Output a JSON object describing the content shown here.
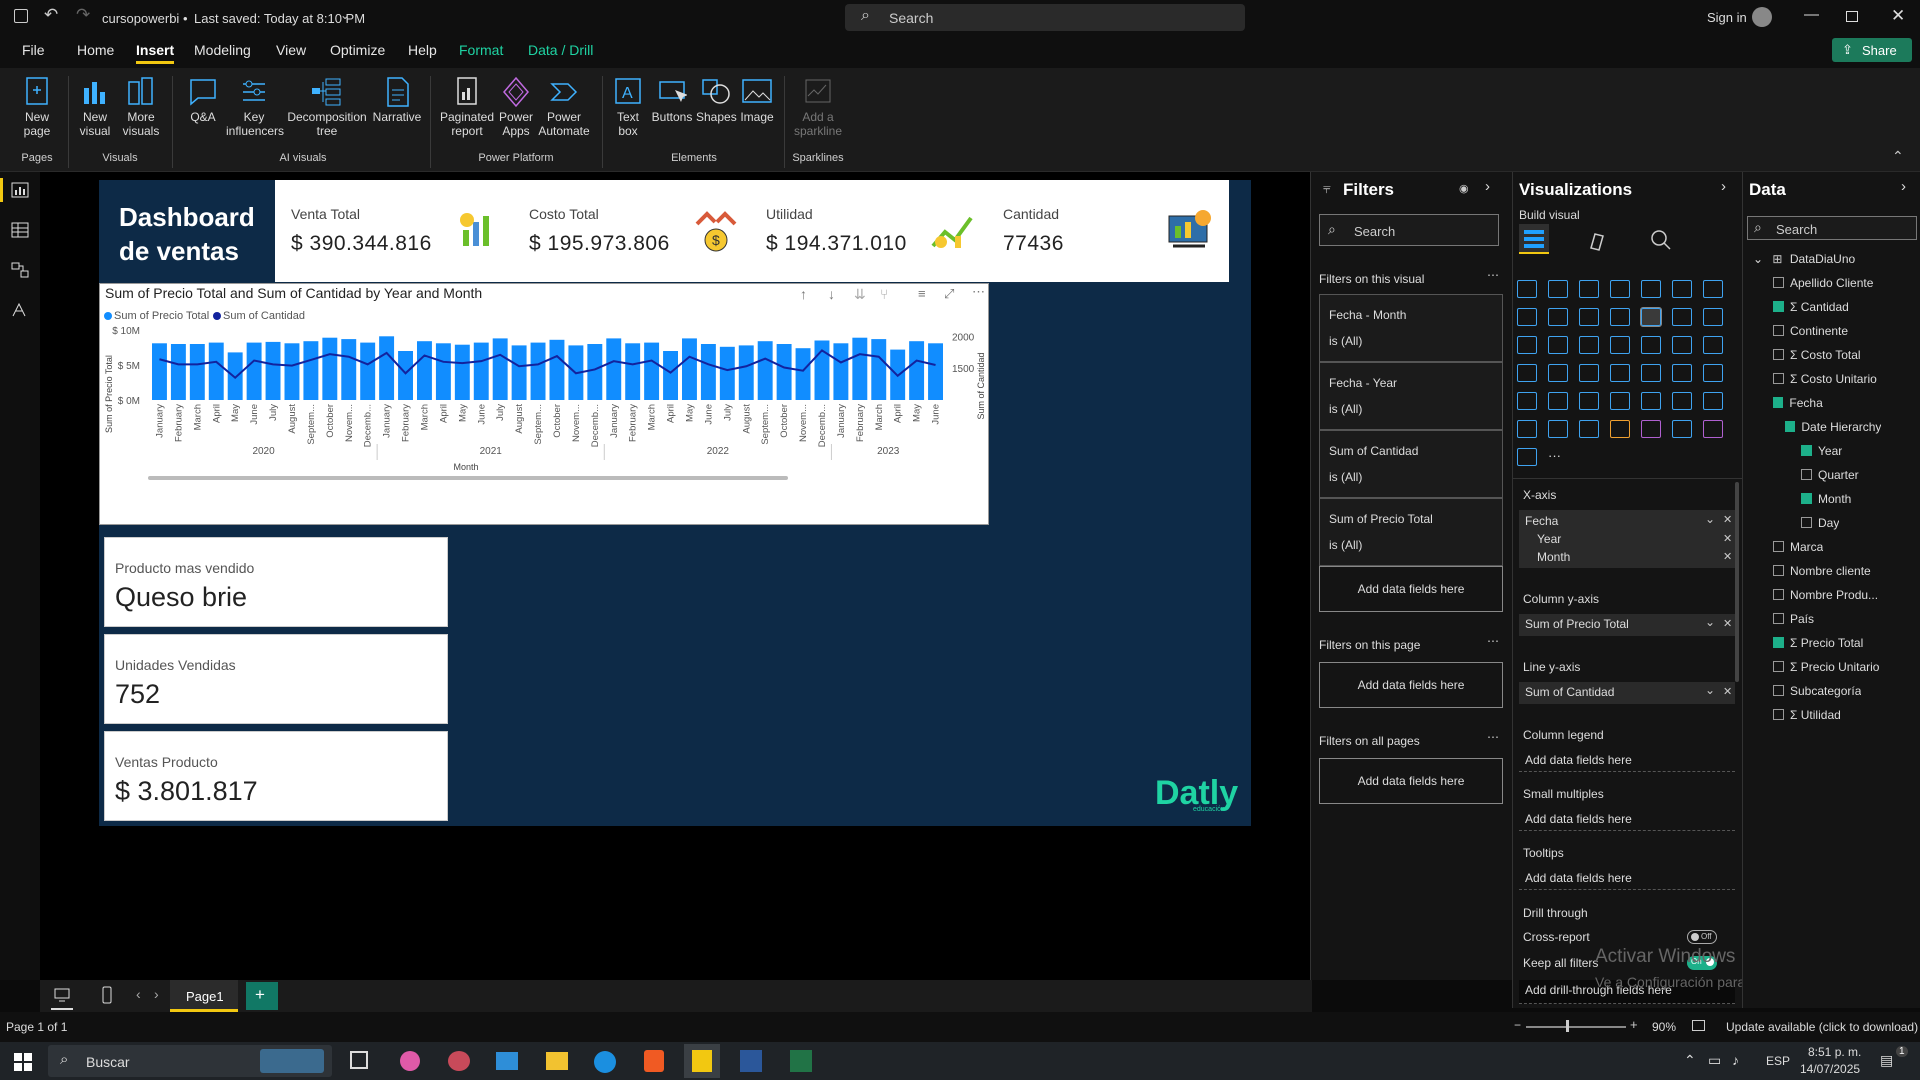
{
  "titlebar": {
    "file_name": "cursopowerbi",
    "saved": "Last saved: Today at 8:10 PM",
    "search_placeholder": "Search",
    "signin": "Sign in",
    "share": "Share"
  },
  "menu": [
    "File",
    "Home",
    "Insert",
    "Modeling",
    "View",
    "Optimize",
    "Help",
    "Format",
    "Data / Drill"
  ],
  "ribbon": {
    "buttons": [
      {
        "label": "New\npage",
        "icon": "new-page-icon"
      },
      {
        "label": "New\nvisual",
        "icon": "new-visual-icon"
      },
      {
        "label": "More\nvisuals",
        "icon": "more-visuals-icon"
      },
      {
        "label": "Q&A",
        "icon": "qa-icon"
      },
      {
        "label": "Key\ninfluencers",
        "icon": "key-influencers-icon"
      },
      {
        "label": "Decomposition\ntree",
        "icon": "decomposition-tree-icon"
      },
      {
        "label": "Narrative",
        "icon": "narrative-icon"
      },
      {
        "label": "Paginated\nreport",
        "icon": "paginated-report-icon"
      },
      {
        "label": "Power\nApps",
        "icon": "power-apps-icon"
      },
      {
        "label": "Power\nAutomate",
        "icon": "power-automate-icon"
      },
      {
        "label": "Text\nbox",
        "icon": "text-box-icon"
      },
      {
        "label": "Buttons",
        "icon": "buttons-icon"
      },
      {
        "label": "Shapes",
        "icon": "shapes-icon"
      },
      {
        "label": "Image",
        "icon": "image-icon"
      },
      {
        "label": "Add a\nsparkline",
        "icon": "sparkline-icon"
      }
    ],
    "groups": [
      "Pages",
      "Visuals",
      "AI visuals",
      "Power Platform",
      "Elements",
      "Sparklines"
    ]
  },
  "dashboard": {
    "title": "Dashboard\nde ventas",
    "kpis": [
      {
        "label": "Venta Total",
        "value": "$ 390.344.816"
      },
      {
        "label": "Costo Total",
        "value": "$ 195.973.806"
      },
      {
        "label": "Utilidad",
        "value": "$ 194.371.010"
      },
      {
        "label": "Cantidad",
        "value": "77436"
      }
    ],
    "cards": [
      {
        "label": "Producto mas vendido",
        "value": "Queso brie"
      },
      {
        "label": "Unidades Vendidas",
        "value": "752"
      },
      {
        "label": "Ventas Producto",
        "value": "$ 3.801.817"
      }
    ],
    "brand": "Datly",
    "brand_sub": "educación"
  },
  "chart_data": {
    "type": "bar",
    "title": "Sum of Precio Total and Sum of Cantidad by Year and Month",
    "legend": [
      "Sum of Precio Total",
      "Sum of Cantidad"
    ],
    "xlabel": "Month",
    "ylabel": "Sum of Precio Total",
    "y2label": "Sum of Cantidad",
    "y_ticks": [
      "$ 10M",
      "$ 5M",
      "$ 0M"
    ],
    "y2_ticks": [
      "2000",
      "1500"
    ],
    "ylim": [
      0,
      10000000
    ],
    "y2lim": [
      1000,
      2100
    ],
    "years": [
      "2020",
      "2021",
      "2022",
      "2023"
    ],
    "year_month_counts": [
      12,
      12,
      12,
      6
    ],
    "categories": [
      "January",
      "February",
      "March",
      "April",
      "May",
      "June",
      "July",
      "August",
      "Septem...",
      "October",
      "Novem...",
      "Decemb...",
      "January",
      "February",
      "March",
      "April",
      "May",
      "June",
      "July",
      "August",
      "Septem...",
      "October",
      "Novem...",
      "Decemb...",
      "January",
      "February",
      "March",
      "April",
      "May",
      "June",
      "July",
      "August",
      "Septem...",
      "October",
      "Novem...",
      "Decemb...",
      "January",
      "February",
      "March",
      "April",
      "May",
      "June"
    ],
    "series": [
      {
        "name": "Sum of Precio Total",
        "color": "#118dff",
        "values": [
          8.1,
          8.0,
          8.0,
          8.2,
          6.8,
          8.2,
          8.3,
          8.1,
          8.4,
          8.9,
          8.7,
          8.2,
          9.1,
          7.0,
          8.4,
          8.1,
          7.9,
          8.2,
          8.8,
          7.8,
          8.2,
          8.6,
          7.8,
          8.0,
          8.8,
          8.1,
          8.2,
          7.0,
          8.8,
          8.0,
          7.6,
          7.8,
          8.4,
          8.0,
          7.4,
          8.5,
          8.1,
          8.9,
          8.7,
          7.2,
          8.4,
          8.1
        ]
      },
      {
        "name": "Sum of Cantidad",
        "color": "#12239e",
        "values": [
          1640,
          1560,
          1560,
          1600,
          1350,
          1620,
          1560,
          1540,
          1630,
          1720,
          1680,
          1560,
          1740,
          1420,
          1700,
          1600,
          1580,
          1610,
          1710,
          1530,
          1560,
          1690,
          1420,
          1480,
          1610,
          1560,
          1620,
          1430,
          1680,
          1560,
          1470,
          1530,
          1650,
          1510,
          1460,
          1780,
          1590,
          1720,
          1680,
          1380,
          1620,
          1550
        ]
      }
    ]
  },
  "filters": {
    "title": "Filters",
    "search": "Search",
    "on_visual": "Filters on this visual",
    "items": [
      {
        "name": "Fecha - Month",
        "state": "is (All)"
      },
      {
        "name": "Fecha - Year",
        "state": "is (All)"
      },
      {
        "name": "Sum of Cantidad",
        "state": "is (All)"
      },
      {
        "name": "Sum of Precio Total",
        "state": "is (All)"
      }
    ],
    "add": "Add data fields here",
    "on_page": "Filters on this page",
    "on_all": "Filters on all pages"
  },
  "visualizations": {
    "title": "Visualizations",
    "build": "Build visual",
    "xaxis": "X-axis",
    "xaxis_fields": [
      "Fecha",
      "Year",
      "Month"
    ],
    "col_y": "Column y-axis",
    "col_y_field": "Sum of Precio Total",
    "line_y": "Line y-axis",
    "line_y_field": "Sum of Cantidad",
    "col_legend": "Column legend",
    "small_mult": "Small multiples",
    "tooltips": "Tooltips",
    "add": "Add data fields here",
    "drill": "Drill through",
    "cross": "Cross-report",
    "cross_state": "Off",
    "keep": "Keep all filters",
    "keep_state": "On",
    "add_drill": "Add drill-through fields here",
    "activate": "Activar Windows",
    "activate_sub": "Ve a Configuración para activar Windows."
  },
  "data": {
    "title": "Data",
    "search": "Search",
    "table": "DataDiaUno",
    "fields": [
      {
        "name": "Apellido Cliente",
        "checked": false,
        "sigma": false,
        "level": 1
      },
      {
        "name": "Cantidad",
        "checked": true,
        "sigma": true,
        "level": 1
      },
      {
        "name": "Continente",
        "checked": false,
        "sigma": false,
        "level": 1
      },
      {
        "name": "Costo Total",
        "checked": false,
        "sigma": true,
        "level": 1
      },
      {
        "name": "Costo Unitario",
        "checked": false,
        "sigma": true,
        "level": 1
      },
      {
        "name": "Fecha",
        "checked": true,
        "sigma": false,
        "level": 1
      },
      {
        "name": "Date Hierarchy",
        "checked": true,
        "sigma": false,
        "level": 2
      },
      {
        "name": "Year",
        "checked": true,
        "sigma": false,
        "level": 3
      },
      {
        "name": "Quarter",
        "checked": false,
        "sigma": false,
        "level": 3
      },
      {
        "name": "Month",
        "checked": true,
        "sigma": false,
        "level": 3
      },
      {
        "name": "Day",
        "checked": false,
        "sigma": false,
        "level": 3
      },
      {
        "name": "Marca",
        "checked": false,
        "sigma": false,
        "level": 1
      },
      {
        "name": "Nombre cliente",
        "checked": false,
        "sigma": false,
        "level": 1
      },
      {
        "name": "Nombre Produ...",
        "checked": false,
        "sigma": false,
        "level": 1
      },
      {
        "name": "País",
        "checked": false,
        "sigma": false,
        "level": 1
      },
      {
        "name": "Precio Total",
        "checked": true,
        "sigma": true,
        "level": 1
      },
      {
        "name": "Precio Unitario",
        "checked": false,
        "sigma": true,
        "level": 1
      },
      {
        "name": "Subcategoría",
        "checked": false,
        "sigma": false,
        "level": 1
      },
      {
        "name": "Utilidad",
        "checked": false,
        "sigma": true,
        "level": 1
      }
    ]
  },
  "tabs": {
    "page1": "Page1"
  },
  "status": {
    "page": "Page 1 of 1",
    "zoom": "90%",
    "update": "Update available (click to download)"
  },
  "taskbar": {
    "search": "Buscar",
    "lang": "ESP",
    "time": "8:51 p. m.",
    "date": "14/07/2025",
    "notif": "1"
  },
  "colors": {
    "accent": "#f2c811",
    "navy": "#0d2a47",
    "bar": "#118dff",
    "line": "#12239e",
    "share_green": "#1c7a5b",
    "check": "#1db08a"
  }
}
